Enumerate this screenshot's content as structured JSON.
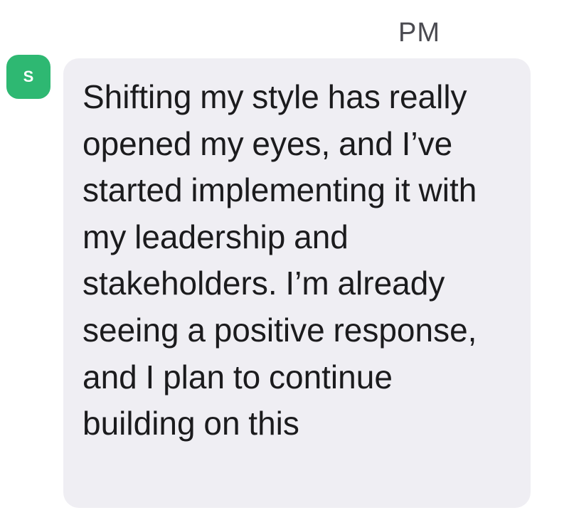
{
  "header": {
    "timestamp": "PM"
  },
  "sender": {
    "avatar_initial": "S",
    "avatar_color": "#2eb872"
  },
  "message": {
    "text": "Shifting my style has really opened my eyes, and I’ve started implementing it with my leadership and stakeholders. I’m already seeing a positive response, and I plan to continue building on this",
    "bubble_color": "#efeef3"
  }
}
